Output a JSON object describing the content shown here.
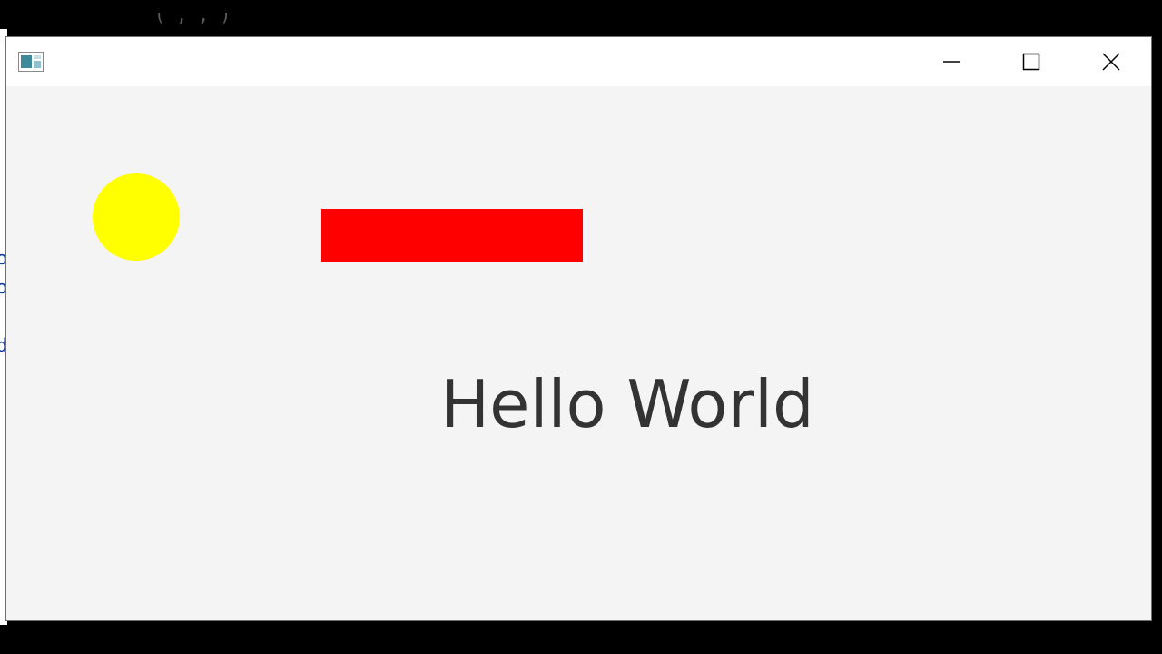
{
  "window": {
    "icon": "app-window-icon",
    "controls": {
      "minimize_icon": "minimize-icon",
      "maximize_icon": "maximize-icon",
      "close_icon": "close-icon"
    }
  },
  "canvas": {
    "circle": {
      "color": "#ffff00"
    },
    "rectangle": {
      "color": "#ff0000"
    },
    "text": {
      "value": "Hello World",
      "color": "#333333"
    }
  },
  "background_editor": {
    "top_fragment": "(         ,       ,         )",
    "side_fragments": [
      "o",
      "o",
      "d"
    ]
  }
}
